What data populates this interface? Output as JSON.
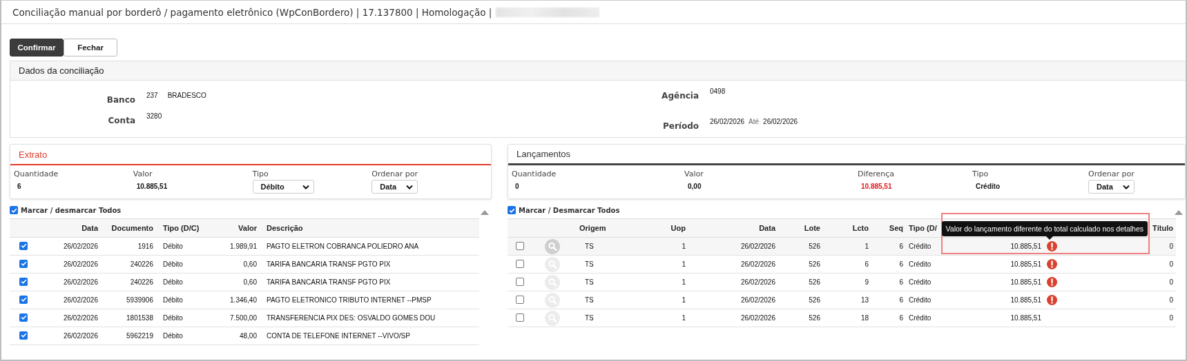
{
  "page_title": "Conciliação manual por borderô / pagamento eletrônico (WpConBordero) | 17.137800 | Homologação |",
  "buttons": [
    {
      "label": "Confirmar",
      "kind": "primary"
    },
    {
      "label": "Fechar",
      "kind": "secondary"
    }
  ],
  "dados": {
    "title": "Dados da conciliação",
    "left": [
      {
        "label": "Banco",
        "values": [
          "237",
          "BRADESCO"
        ]
      },
      {
        "label": "Conta",
        "values": [
          "3280"
        ]
      }
    ],
    "right": [
      {
        "label": "Agência",
        "values": [
          "0498"
        ]
      },
      {
        "label": "Período",
        "values": [
          "26/02/2026",
          "26/02/2026"
        ],
        "separator": "Até"
      }
    ]
  },
  "extrato": {
    "title": "Extrato",
    "selected": true,
    "summary": [
      {
        "label": "Quantidade",
        "value": "6",
        "kind": "text"
      },
      {
        "label": "Valor",
        "value": "10.885,51",
        "kind": "text"
      },
      {
        "label": "Tipo",
        "value": "Débito",
        "kind": "select"
      },
      {
        "label": "Ordenar por",
        "value": "Data",
        "kind": "select"
      }
    ],
    "select_all": {
      "label": "Marcar / desmarcar Todos",
      "checked": true
    },
    "columns": [
      "Data",
      "Documento",
      "Tipo (D/C)",
      "Valor",
      "Descrição"
    ],
    "rows": [
      {
        "checked": true,
        "cells": [
          "26/02/2026",
          "1916",
          "Débito",
          "1.989,91",
          "PAGTO ELETRON COBRANCA POLIEDRO ANA"
        ]
      },
      {
        "checked": true,
        "cells": [
          "26/02/2026",
          "240226",
          "Débito",
          "0,60",
          "TARIFA BANCARIA TRANSF PGTO PIX"
        ]
      },
      {
        "checked": true,
        "cells": [
          "26/02/2026",
          "240226",
          "Débito",
          "0,60",
          "TARIFA BANCARIA TRANSF PGTO PIX"
        ]
      },
      {
        "checked": true,
        "cells": [
          "26/02/2026",
          "5939906",
          "Débito",
          "1.346,40",
          "PAGTO ELETRONICO TRIBUTO INTERNET --PMSP"
        ]
      },
      {
        "checked": true,
        "cells": [
          "26/02/2026",
          "1801538",
          "Débito",
          "7.500,00",
          "TRANSFERENCIA PIX DES: OSVALDO GOMES DOU"
        ]
      },
      {
        "checked": true,
        "cells": [
          "26/02/2026",
          "5962219",
          "Débito",
          "48,00",
          "CONTA DE TELEFONE INTERNET --VIVO/SP"
        ]
      }
    ]
  },
  "lancamentos": {
    "title": "Lançamentos",
    "selected": false,
    "summary": [
      {
        "label": "Quantidade",
        "value": "0",
        "kind": "text"
      },
      {
        "label": "Valor",
        "value": "0,00",
        "kind": "text"
      },
      {
        "label": "Diferença",
        "value": "10.885,51",
        "kind": "alert"
      },
      {
        "label": "Tipo",
        "value": "Crédito",
        "kind": "text"
      },
      {
        "label": "Ordenar por",
        "value": "Data",
        "kind": "select"
      }
    ],
    "select_all": {
      "label": "Marcar / Desmarcar Todos",
      "checked": true
    },
    "columns": [
      "Origem",
      "Uop",
      "Data",
      "Lote",
      "Lcto",
      "Seq",
      "Tipo (D/",
      "Título"
    ],
    "rows": [
      {
        "checked": false,
        "hovered": true,
        "cells": [
          "TS",
          "1",
          "26/02/2026",
          "526",
          "1",
          "6",
          "Crédito",
          "10.885,51"
        ],
        "warning": true,
        "tooltip": "Valor do lançamento diferente do total calculado nos detalhes",
        "titulo": "0"
      },
      {
        "checked": false,
        "hovered": false,
        "cells": [
          "TS",
          "1",
          "26/02/2026",
          "526",
          "6",
          "6",
          "Crédito",
          "10.885,51"
        ],
        "warning": true,
        "titulo": "0"
      },
      {
        "checked": false,
        "hovered": false,
        "cells": [
          "TS",
          "1",
          "26/02/2026",
          "526",
          "9",
          "6",
          "Crédito",
          "10.885,51"
        ],
        "warning": true,
        "titulo": "0"
      },
      {
        "checked": false,
        "hovered": false,
        "cells": [
          "TS",
          "1",
          "26/02/2026",
          "526",
          "13",
          "6",
          "Crédito",
          "10.885,51"
        ],
        "warning": true,
        "titulo": "0"
      },
      {
        "checked": false,
        "hovered": false,
        "cells": [
          "TS",
          "1",
          "26/02/2026",
          "526",
          "18",
          "6",
          "Crédito",
          "10.885,51"
        ],
        "warning": false,
        "titulo": "0"
      }
    ]
  }
}
